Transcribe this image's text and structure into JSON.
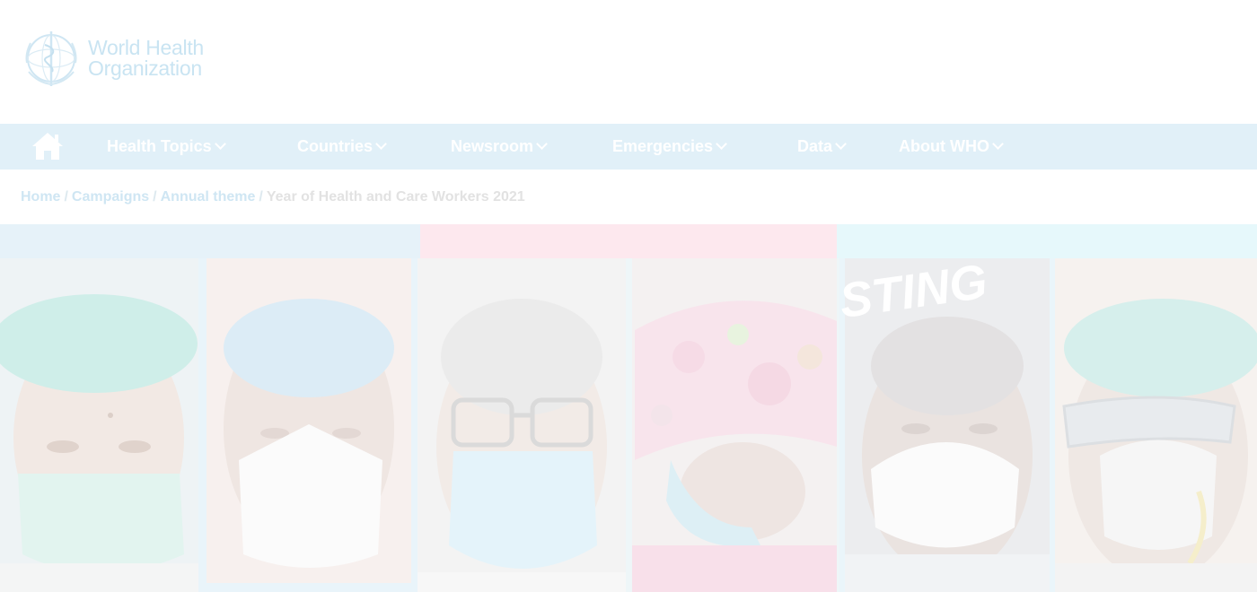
{
  "brand": {
    "logo_line1": "World Health",
    "logo_line2": "Organization"
  },
  "nav": {
    "home_icon": "home-icon",
    "items": [
      {
        "label": "Health Topics"
      },
      {
        "label": "Countries"
      },
      {
        "label": "Newsroom"
      },
      {
        "label": "Emergencies"
      },
      {
        "label": "Data"
      },
      {
        "label": "About WHO"
      }
    ]
  },
  "breadcrumb": {
    "links": [
      "Home",
      "Campaigns",
      "Annual theme"
    ],
    "separator": "/",
    "current": "Year of Health and Care Workers 2021"
  },
  "banner": {
    "sign_text": "STING"
  },
  "colors": {
    "nav_bg": "#e1f0f8",
    "link": "#cfe6f3",
    "band_blue": "#e6f2f9",
    "band_pink": "#fde8ee",
    "band_cyan": "#e6f8fb"
  }
}
